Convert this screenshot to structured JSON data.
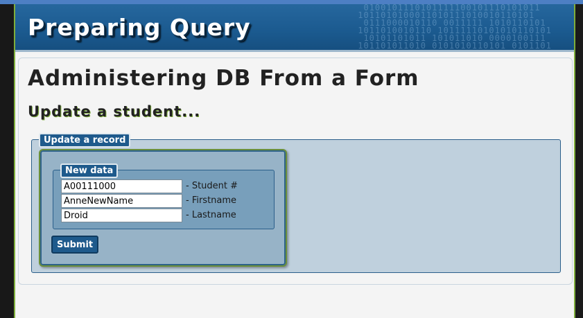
{
  "header": {
    "title": "Preparing Query",
    "decoration": "binary-digits-pattern"
  },
  "page": {
    "heading": "Administering DB From a Form",
    "subheading": "Update a student..."
  },
  "form": {
    "outer_legend": "Update a record",
    "inner_legend": "New data",
    "fields": [
      {
        "value": "A00111000",
        "label": "- Student #"
      },
      {
        "value": "AnneNewName",
        "label": "- Firstname"
      },
      {
        "value": "Droid",
        "label": "- Lastname"
      }
    ],
    "submit_label": "Submit"
  },
  "colors": {
    "header_blue": "#1b5a8f",
    "accent_green": "#7fae3c",
    "fieldset_bg": "#bfd0dd",
    "inner_fieldset_bg": "#789fbb"
  }
}
